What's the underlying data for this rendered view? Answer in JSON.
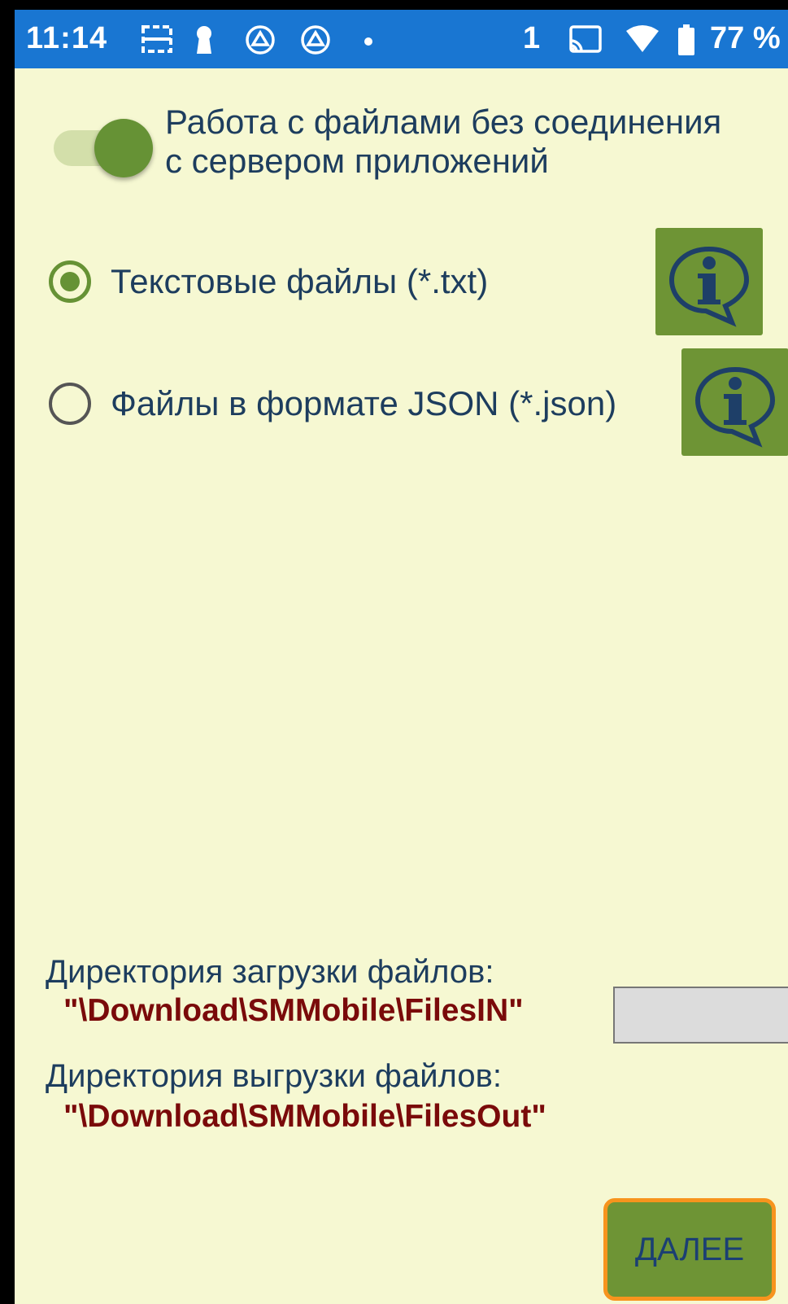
{
  "status_bar": {
    "time": "11:14",
    "notification_count": "1",
    "battery": "77 %"
  },
  "offline_toggle": {
    "label_line1": "Работа с файлами без соединения",
    "label_line2": "с сервером приложений",
    "checked": true
  },
  "file_format": {
    "options": [
      {
        "label": "Текстовые файлы (*.txt)",
        "selected": true
      },
      {
        "label": "Файлы в формате JSON (*.json)",
        "selected": false
      }
    ]
  },
  "directories": {
    "upload_label": "Директория загрузки файлов:",
    "upload_path": "\"\\Download\\SMMobile\\FilesIN\"",
    "download_label": "Директория выгрузки файлов:",
    "download_path": "\"\\Download\\SMMobile\\FilesOut\""
  },
  "actions": {
    "next_label": "ДАЛЕЕ"
  },
  "colors": {
    "status_bar": "#1976d2",
    "background": "#f6f8d2",
    "accent_green": "#669235",
    "label_text": "#1d3d5e",
    "path_text": "#7a0a0a",
    "focus_border": "#f7941d"
  }
}
